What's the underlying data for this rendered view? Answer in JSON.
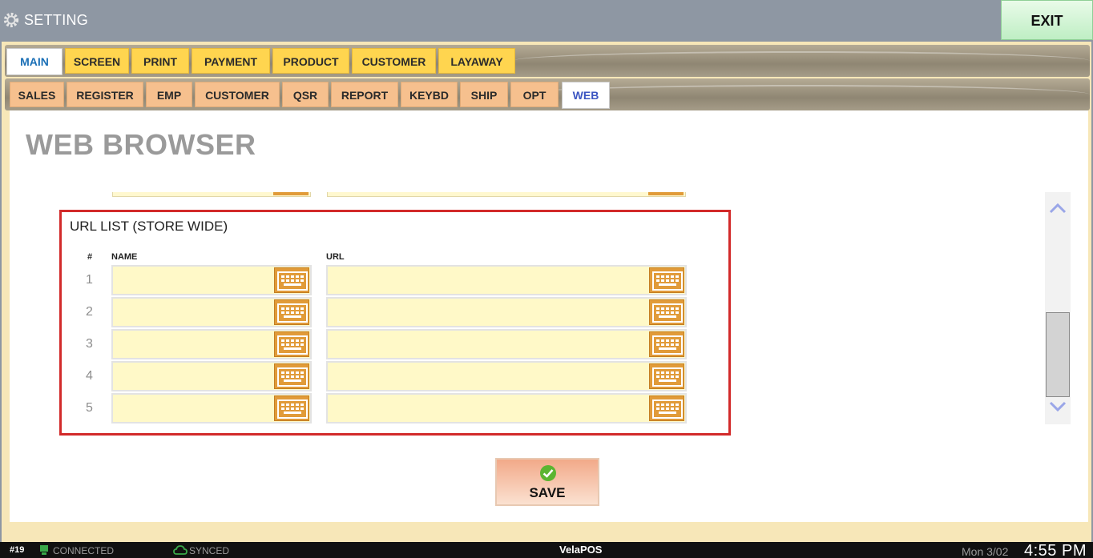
{
  "window": {
    "title": "SETTING",
    "exit_label": "EXIT"
  },
  "main_tabs": [
    {
      "label": "MAIN",
      "active": true
    },
    {
      "label": "SCREEN"
    },
    {
      "label": "PRINT"
    },
    {
      "label": "PAYMENT"
    },
    {
      "label": "PRODUCT"
    },
    {
      "label": "CUSTOMER"
    },
    {
      "label": "LAYAWAY"
    }
  ],
  "sub_tabs": [
    {
      "label": "SALES"
    },
    {
      "label": "REGISTER"
    },
    {
      "label": "EMP"
    },
    {
      "label": "CUSTOMER"
    },
    {
      "label": "QSR"
    },
    {
      "label": "REPORT"
    },
    {
      "label": "KEYBD"
    },
    {
      "label": "SHIP"
    },
    {
      "label": "OPT"
    },
    {
      "label": "WEB",
      "active": true
    }
  ],
  "page": {
    "title": "WEB BROWSER"
  },
  "url_list": {
    "heading": "URL LIST (STORE WIDE)",
    "col_hash": "#",
    "col_name": "NAME",
    "col_url": "URL",
    "rows": [
      {
        "num": "1",
        "name": "",
        "url": ""
      },
      {
        "num": "2",
        "name": "",
        "url": ""
      },
      {
        "num": "3",
        "name": "",
        "url": ""
      },
      {
        "num": "4",
        "name": "",
        "url": ""
      },
      {
        "num": "5",
        "name": "",
        "url": ""
      }
    ]
  },
  "save": {
    "label": "SAVE"
  },
  "status": {
    "station": "#19",
    "connection": "CONNECTED",
    "sync": "SYNCED",
    "brand": "VelaPOS",
    "date": "Mon 3/02",
    "time": "4:55 PM"
  },
  "colors": {
    "accent_tab": "#ffd54f",
    "sub_tab": "#f6c08e",
    "keyboard_button": "#e19b39",
    "field_bg": "#fff9c8",
    "highlight_box": "#d22a2a"
  }
}
